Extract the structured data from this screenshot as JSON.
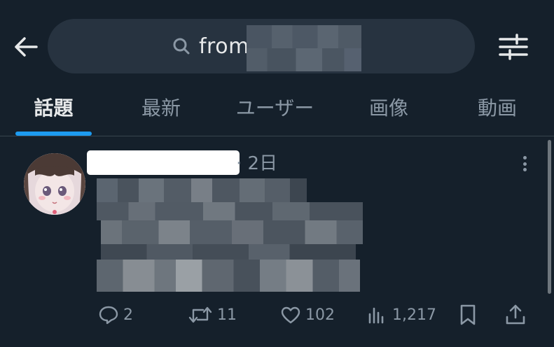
{
  "search": {
    "query": "from",
    "back_icon": "arrow-left-icon",
    "search_icon": "search-icon",
    "filter_icon": "sliders-icon"
  },
  "tabs": [
    {
      "label": "話題",
      "active": true
    },
    {
      "label": "最新",
      "active": false
    },
    {
      "label": "ユーザー",
      "active": false
    },
    {
      "label": "画像",
      "active": false
    },
    {
      "label": "動画",
      "active": false
    }
  ],
  "post": {
    "time": "· 2日",
    "stats": {
      "replies": "2",
      "reposts": "11",
      "likes": "102",
      "views": "1,217"
    }
  },
  "colors": {
    "background": "#15202b",
    "accent": "#1d9bf0",
    "muted": "#8b98a5",
    "pill": "#273340"
  }
}
